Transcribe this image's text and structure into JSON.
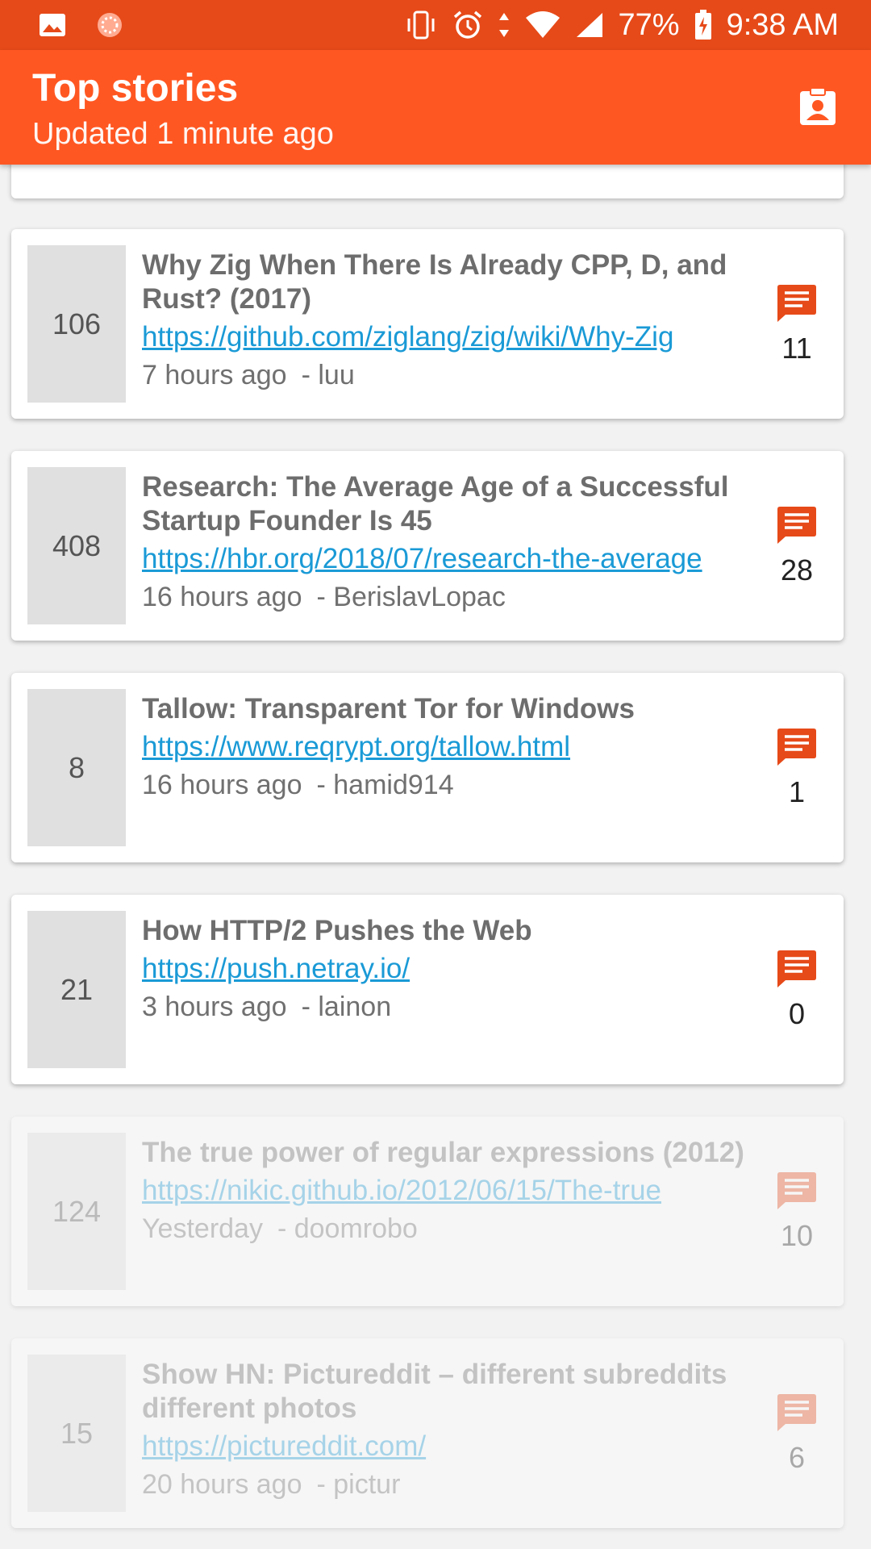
{
  "status_bar": {
    "battery": "77%",
    "time": "9:38 AM",
    "icons": [
      "image-icon",
      "notification-dot-icon",
      "vibrate-icon",
      "alarm-icon",
      "data-arrows-icon",
      "wifi-icon",
      "signal-icon",
      "battery-charging-icon"
    ]
  },
  "app_bar": {
    "title": "Top stories",
    "subtitle": "Updated 1 minute ago",
    "action_icon": "account-box-icon"
  },
  "colors": {
    "status_bar": "#e64a19",
    "app_bar": "#ff5722",
    "link": "#1a9ad6",
    "comment_icon": "#e64a19"
  },
  "stories": [
    {
      "score": "106",
      "title": "Why Zig When There Is Already CPP, D, and Rust? (2017)",
      "url": "https://github.com/ziglang/zig/wiki/Why-Zig",
      "time": "7 hours ago",
      "author": "- luu",
      "comments": "11"
    },
    {
      "score": "408",
      "title": "Research: The Average Age of a Successful Startup Founder Is 45",
      "url": "https://hbr.org/2018/07/research-the-average",
      "time": "16 hours ago",
      "author": "- BerislavLopac",
      "comments": "28"
    },
    {
      "score": "8",
      "title": "Tallow: Transparent Tor for Windows",
      "url": "https://www.reqrypt.org/tallow.html",
      "time": "16 hours ago",
      "author": "- hamid914",
      "comments": "1"
    },
    {
      "score": "21",
      "title": "How HTTP/2 Pushes the Web",
      "url": "https://push.netray.io/",
      "time": "3 hours ago",
      "author": "- lainon",
      "comments": "0"
    },
    {
      "score": "124",
      "title": "The true power of regular expressions (2012)",
      "url": "https://nikic.github.io/2012/06/15/The-true",
      "time": "Yesterday",
      "author": "- doomrobo",
      "comments": "10"
    },
    {
      "score": "15",
      "title": "Show HN: Pictureddit – different subreddits different photos",
      "url": "https://pictureddit.com/",
      "time": "20 hours ago",
      "author": "- pictur",
      "comments": "6"
    }
  ]
}
